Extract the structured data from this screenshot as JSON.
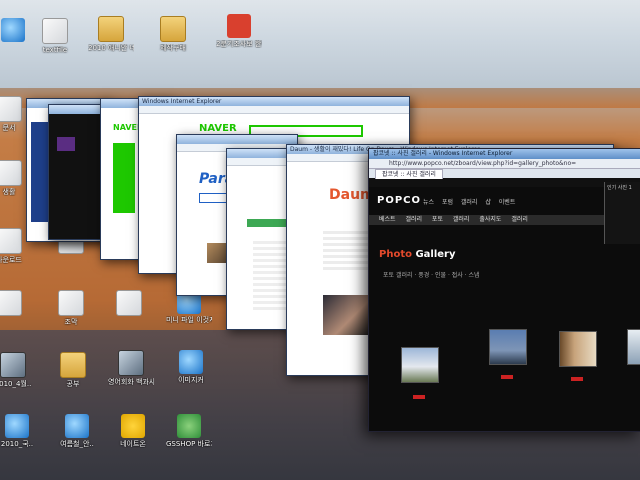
{
  "desktop": {
    "icons": [
      {
        "name": "ie-icon-topleft",
        "label": "",
        "type": "ie"
      },
      {
        "name": "textfile-icon",
        "label": "textfile",
        "type": "doc"
      },
      {
        "name": "folder-icon-1",
        "label": "2010 애니안 네이버",
        "type": "folder"
      },
      {
        "name": "folder-icon-2",
        "label": "제작구매",
        "type": "folder"
      },
      {
        "name": "shortcut-10-icon",
        "label": "2분기조사보 한정판.클립",
        "type": "badge"
      },
      {
        "name": "doc-icon-left-1",
        "label": "문서",
        "type": "doc"
      },
      {
        "name": "doc-icon-left-2",
        "label": "생활",
        "type": "doc"
      },
      {
        "name": "folder-icon-3",
        "label": "다운로드",
        "type": "doc"
      },
      {
        "name": "doc-icon-row2-1",
        "label": "조막",
        "type": "doc"
      },
      {
        "name": "doc-icon-row2-2",
        "label": "",
        "type": "doc"
      },
      {
        "name": "ie-icon-row2-1",
        "label": "미니 파일 이것저것",
        "type": "ie"
      },
      {
        "name": "ie-icon-row2-2",
        "label": "다운",
        "type": "ie"
      },
      {
        "name": "media-icon-left",
        "label": "2010_4월..",
        "type": "media"
      },
      {
        "name": "folder-icon-4",
        "label": "공부",
        "type": "folder"
      },
      {
        "name": "media-icon-2",
        "label": "영어회화 백과사전",
        "type": "media"
      },
      {
        "name": "ie-icon-row3",
        "label": "이미지커",
        "type": "ie"
      },
      {
        "name": "ie-icon-bottom-1",
        "label": "2010_국..",
        "type": "ie"
      },
      {
        "name": "ie-icon-bottom-2",
        "label": "여름철_안..",
        "type": "ie"
      },
      {
        "name": "chat-icon",
        "label": "네이트온",
        "type": "chat"
      },
      {
        "name": "gsshop-icon",
        "label": "GSSHOP 바로가기",
        "type": "gs"
      }
    ]
  },
  "windows": {
    "naver_title": "Windows Internet Explorer",
    "naver_logo": "NAVER",
    "paran_logo": "Paran",
    "daum_title": "Daum - 생활이 재밌다! Life On Daum - Windows Internet Explorer",
    "daum_logo": "Daum",
    "popco_title": "팝코넷 :: 사진 갤러리 - Windows Internet Explorer",
    "popco_url": "http://www.popco.net/zboard/view.php?id=gallery_photo&no=",
    "popco_tab": "팝코넷 :: 사진 갤러리",
    "popco_logo": "POPCO",
    "popco_gnb": "뉴스 포럼 갤러리 샵 이벤트",
    "popco_subnav": "베스트 갤러리  포토 갤러리  출사지도 갤러리",
    "popco_gallery_word": "Photo",
    "popco_gallery_word2": "Gallery",
    "popco_side": "포토 갤러리 · 풍경 · 인물 · 접사 · 스냅",
    "popco_right_text": "인기 사진 1"
  }
}
